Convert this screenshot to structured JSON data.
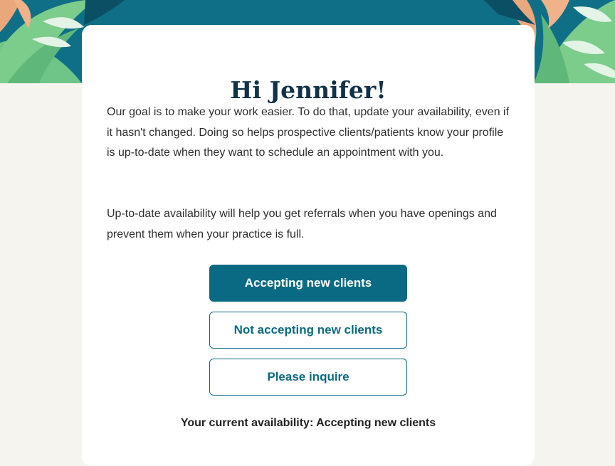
{
  "colors": {
    "primary": "#0b6a83",
    "hero_background": "#0e6f86",
    "page_background": "#f6f4ef",
    "leaf_green": "#7ccc8b",
    "leaf_peach": "#eba77c"
  },
  "greeting": "Hi Jennifer!",
  "intro_paragraph": "Our goal is to make your work easier. To do that, update your availability, even if it hasn't changed. Doing so helps prospective clients/patients know your profile is up-to-date when they want to schedule an appointment with you.",
  "referral_paragraph": "Up-to-date availability will help you get referrals when you have openings and prevent them when your practice is full.",
  "options": {
    "accepting": "Accepting new clients",
    "not_accepting": "Not accepting new clients",
    "inquire": "Please inquire"
  },
  "current_availability": "Your current availability: Accepting new clients"
}
